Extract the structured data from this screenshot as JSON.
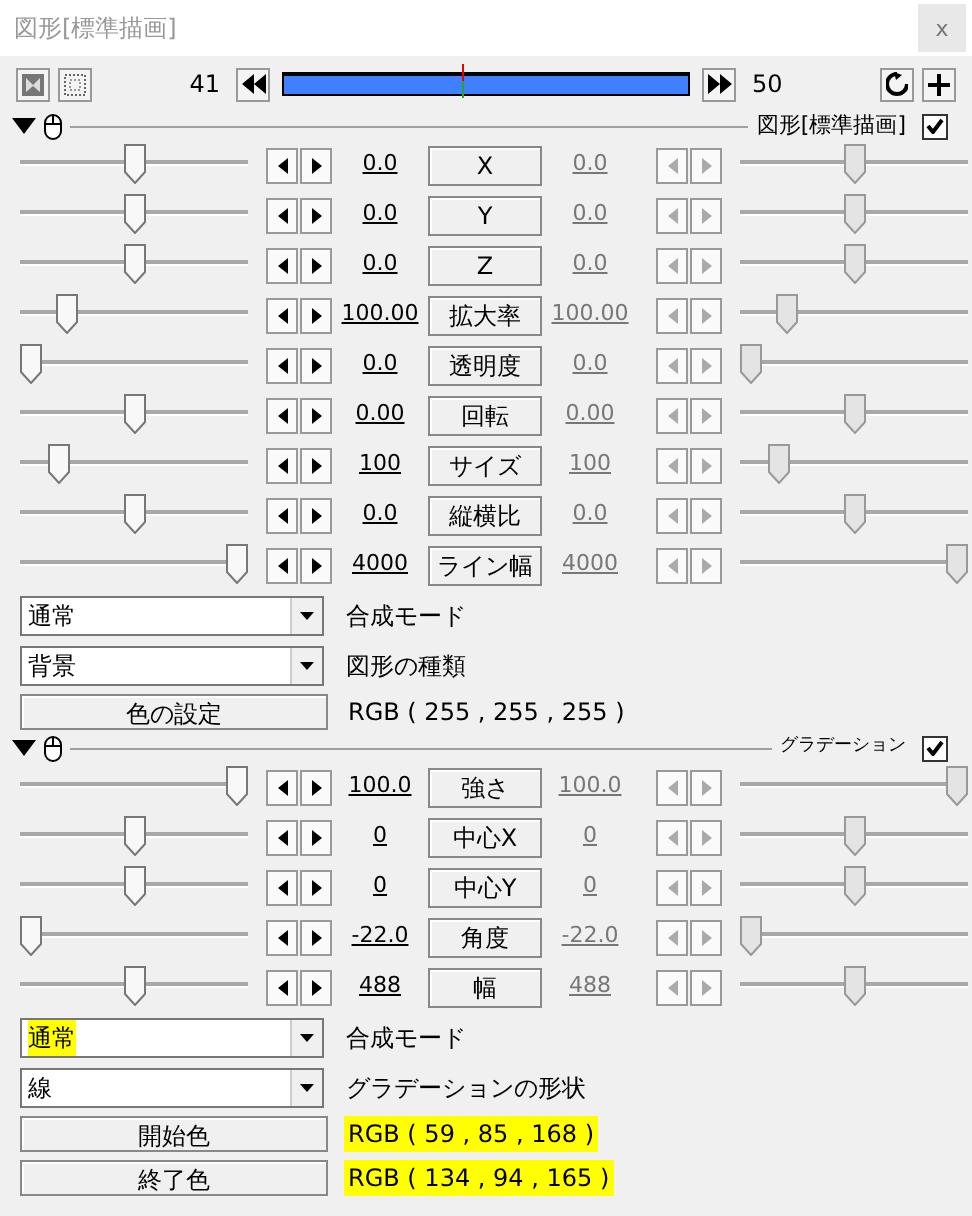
{
  "window": {
    "title": "図形[標準描画]",
    "close": "x"
  },
  "toolbar": {
    "start_frame": "41",
    "end_frame": "50",
    "level": 0.44
  },
  "sections": [
    {
      "title": "図形[標準描画]",
      "expanded": true,
      "checked": true,
      "params": [
        {
          "label": "X",
          "start": {
            "value": "0.0",
            "level": 0.5
          },
          "end": {
            "value": "0.0",
            "level": 0.5,
            "disabled": true
          }
        },
        {
          "label": "Y",
          "start": {
            "value": "0.0",
            "level": 0.5
          },
          "end": {
            "value": "0.0",
            "level": 0.5,
            "disabled": true
          }
        },
        {
          "label": "Z",
          "start": {
            "value": "0.0",
            "level": 0.5
          },
          "end": {
            "value": "0.0",
            "level": 0.5,
            "disabled": true
          }
        },
        {
          "label": "拡大率",
          "start": {
            "value": "100.00",
            "level": 0.17
          },
          "end": {
            "value": "100.00",
            "level": 0.17,
            "disabled": true
          }
        },
        {
          "label": "透明度",
          "start": {
            "value": "0.0",
            "level": 0.0
          },
          "end": {
            "value": "0.0",
            "level": 0.0,
            "disabled": true
          }
        },
        {
          "label": "回転",
          "start": {
            "value": "0.00",
            "level": 0.5
          },
          "end": {
            "value": "0.00",
            "level": 0.5,
            "disabled": true
          }
        },
        {
          "label": "サイズ",
          "start": {
            "value": "100",
            "level": 0.14
          },
          "end": {
            "value": "100",
            "level": 0.14,
            "disabled": true
          }
        },
        {
          "label": "縦横比",
          "start": {
            "value": "0.0",
            "level": 0.5
          },
          "end": {
            "value": "0.0",
            "level": 0.5,
            "disabled": true
          }
        },
        {
          "label": "ライン幅",
          "start": {
            "value": "4000",
            "level": 1.0
          },
          "end": {
            "value": "4000",
            "level": 1.0,
            "disabled": true
          }
        }
      ],
      "settings": [
        {
          "kind": "dropdown",
          "value": "通常",
          "highlighted": false,
          "label": "合成モード"
        },
        {
          "kind": "dropdown",
          "value": "背景",
          "highlighted": false,
          "label": "図形の種類"
        },
        {
          "kind": "color",
          "button": "色の設定",
          "value": "RGB ( 255 , 255 , 255 )",
          "highlighted": false
        }
      ]
    },
    {
      "title": "グラデーション",
      "expanded": true,
      "checked": true,
      "params": [
        {
          "label": "強さ",
          "start": {
            "value": "100.0",
            "level": 1.0
          },
          "end": {
            "value": "100.0",
            "level": 1.0,
            "disabled": true
          }
        },
        {
          "label": "中心X",
          "start": {
            "value": "0",
            "level": 0.5
          },
          "end": {
            "value": "0",
            "level": 0.5,
            "disabled": true
          }
        },
        {
          "label": "中心Y",
          "start": {
            "value": "0",
            "level": 0.5
          },
          "end": {
            "value": "0",
            "level": 0.5,
            "disabled": true
          }
        },
        {
          "label": "角度",
          "start": {
            "value": "-22.0",
            "level": 0.0
          },
          "end": {
            "value": "-22.0",
            "level": 0.0,
            "disabled": true
          }
        },
        {
          "label": "幅",
          "start": {
            "value": "488",
            "level": 0.5
          },
          "end": {
            "value": "488",
            "level": 0.5,
            "disabled": true
          }
        }
      ],
      "settings": [
        {
          "kind": "dropdown",
          "value": "通常",
          "highlighted": true,
          "label": "合成モード"
        },
        {
          "kind": "dropdown",
          "value": "線",
          "highlighted": false,
          "label": "グラデーションの形状"
        },
        {
          "kind": "color",
          "button": "開始色",
          "value": "RGB ( 59 , 85 , 168 )",
          "highlighted": true
        },
        {
          "kind": "color",
          "button": "終了色",
          "value": "RGB ( 134 , 94 , 165 )",
          "highlighted": true
        }
      ]
    }
  ]
}
